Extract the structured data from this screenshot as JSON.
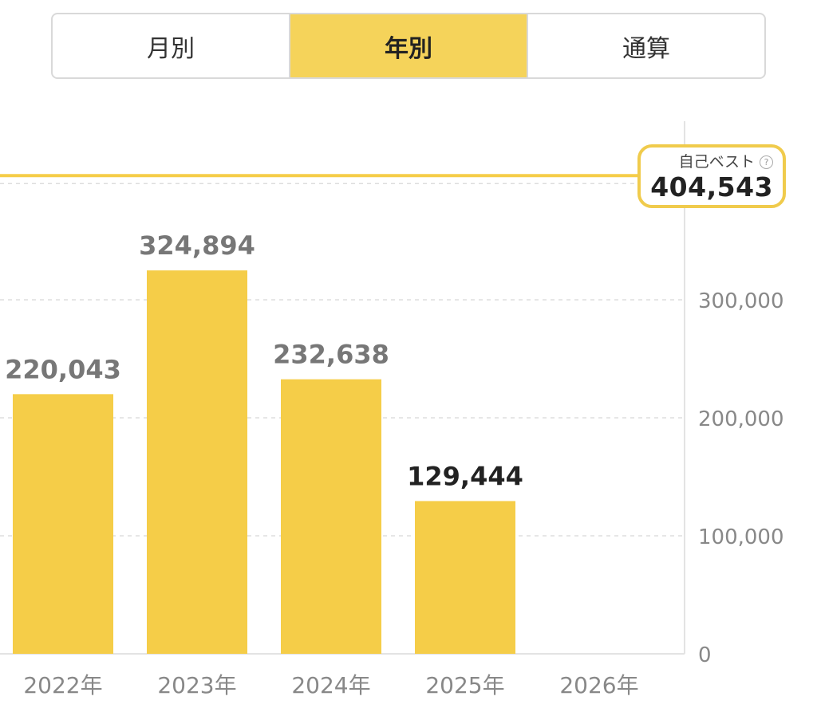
{
  "tabs": [
    {
      "label": "月別",
      "active": false
    },
    {
      "label": "年別",
      "active": true
    },
    {
      "label": "通算",
      "active": false
    }
  ],
  "best": {
    "label": "自己ベスト",
    "value": "404,543",
    "help_icon": "question-circle-icon"
  },
  "colors": {
    "accent": "#f5cd48",
    "bar": "#f5cd48",
    "value_label_past": "#777777",
    "value_label_current": "#222222",
    "axis_text": "#888888",
    "grid": "#dddddd"
  },
  "chart_data": {
    "type": "bar",
    "categories": [
      "2022年",
      "2023年",
      "2024年",
      "2025年",
      "2026年"
    ],
    "values": [
      220043,
      324894,
      232638,
      129444,
      null
    ],
    "value_labels": [
      "220,043",
      "324,894",
      "232,638",
      "129,444",
      ""
    ],
    "ylim": [
      0,
      450000
    ],
    "yticks": [
      0,
      100000,
      200000,
      300000
    ],
    "ytick_labels": [
      "0",
      "100,000",
      "200,000",
      "300,000"
    ],
    "reference_line": {
      "value": 404543
    },
    "grid": true,
    "y_axis_side": "right"
  }
}
